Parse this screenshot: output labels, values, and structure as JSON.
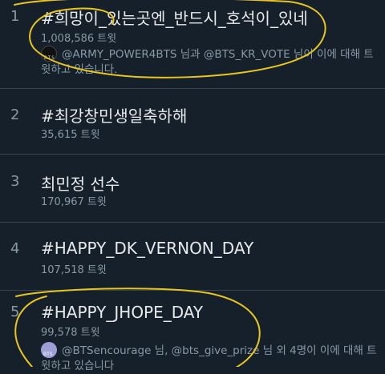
{
  "trends": [
    {
      "rank": "1",
      "title": "#희망이_있는곳엔_반드시_호석이_있네",
      "count": "1,008,586 트윗",
      "context": {
        "user1": "@ARMY_POWER4BTS",
        "joiner": " 님과 ",
        "user2": "@BTS_KR_VOTE",
        "tail": " 님이 이에 대해 트윗하고 있습니다.",
        "avatar_text": "BTS"
      }
    },
    {
      "rank": "2",
      "title": "#최강창민생일축하해",
      "count": "35,615 트윗"
    },
    {
      "rank": "3",
      "title": "최민정 선수",
      "count": "170,967 트윗"
    },
    {
      "rank": "4",
      "title": "#HAPPY_DK_VERNON_DAY",
      "count": "107,518 트윗"
    },
    {
      "rank": "5",
      "title": "#HAPPY_JHOPE_DAY",
      "count": "99,578 트윗",
      "context": {
        "user1": "@BTSencourage",
        "joiner": " 님, ",
        "user2": "@bts_give_prize",
        "tail": " 님 외 4명이 이에 대해 트윗하고 있습니다",
        "avatar_text": "BTS"
      }
    }
  ],
  "colors": {
    "background": "#15202b",
    "divider": "#38444d",
    "primary_text": "#e7e9ea",
    "secondary_text": "#8899a6",
    "annotation": "#e8c521"
  }
}
